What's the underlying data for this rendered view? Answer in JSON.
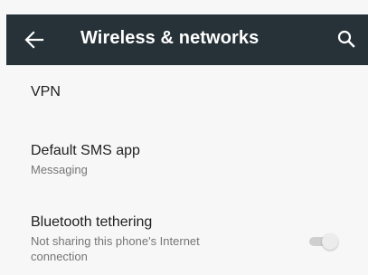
{
  "header": {
    "title": "Wireless & networks",
    "back_icon": "arrow-back-icon",
    "search_icon": "search-icon",
    "background": "#263238"
  },
  "settings": [
    {
      "title": "VPN"
    },
    {
      "title": "Default SMS app",
      "summary": "Messaging"
    },
    {
      "title": "Bluetooth tethering",
      "summary": "Not sharing this phone's Internet connection",
      "toggle_on": false
    }
  ]
}
